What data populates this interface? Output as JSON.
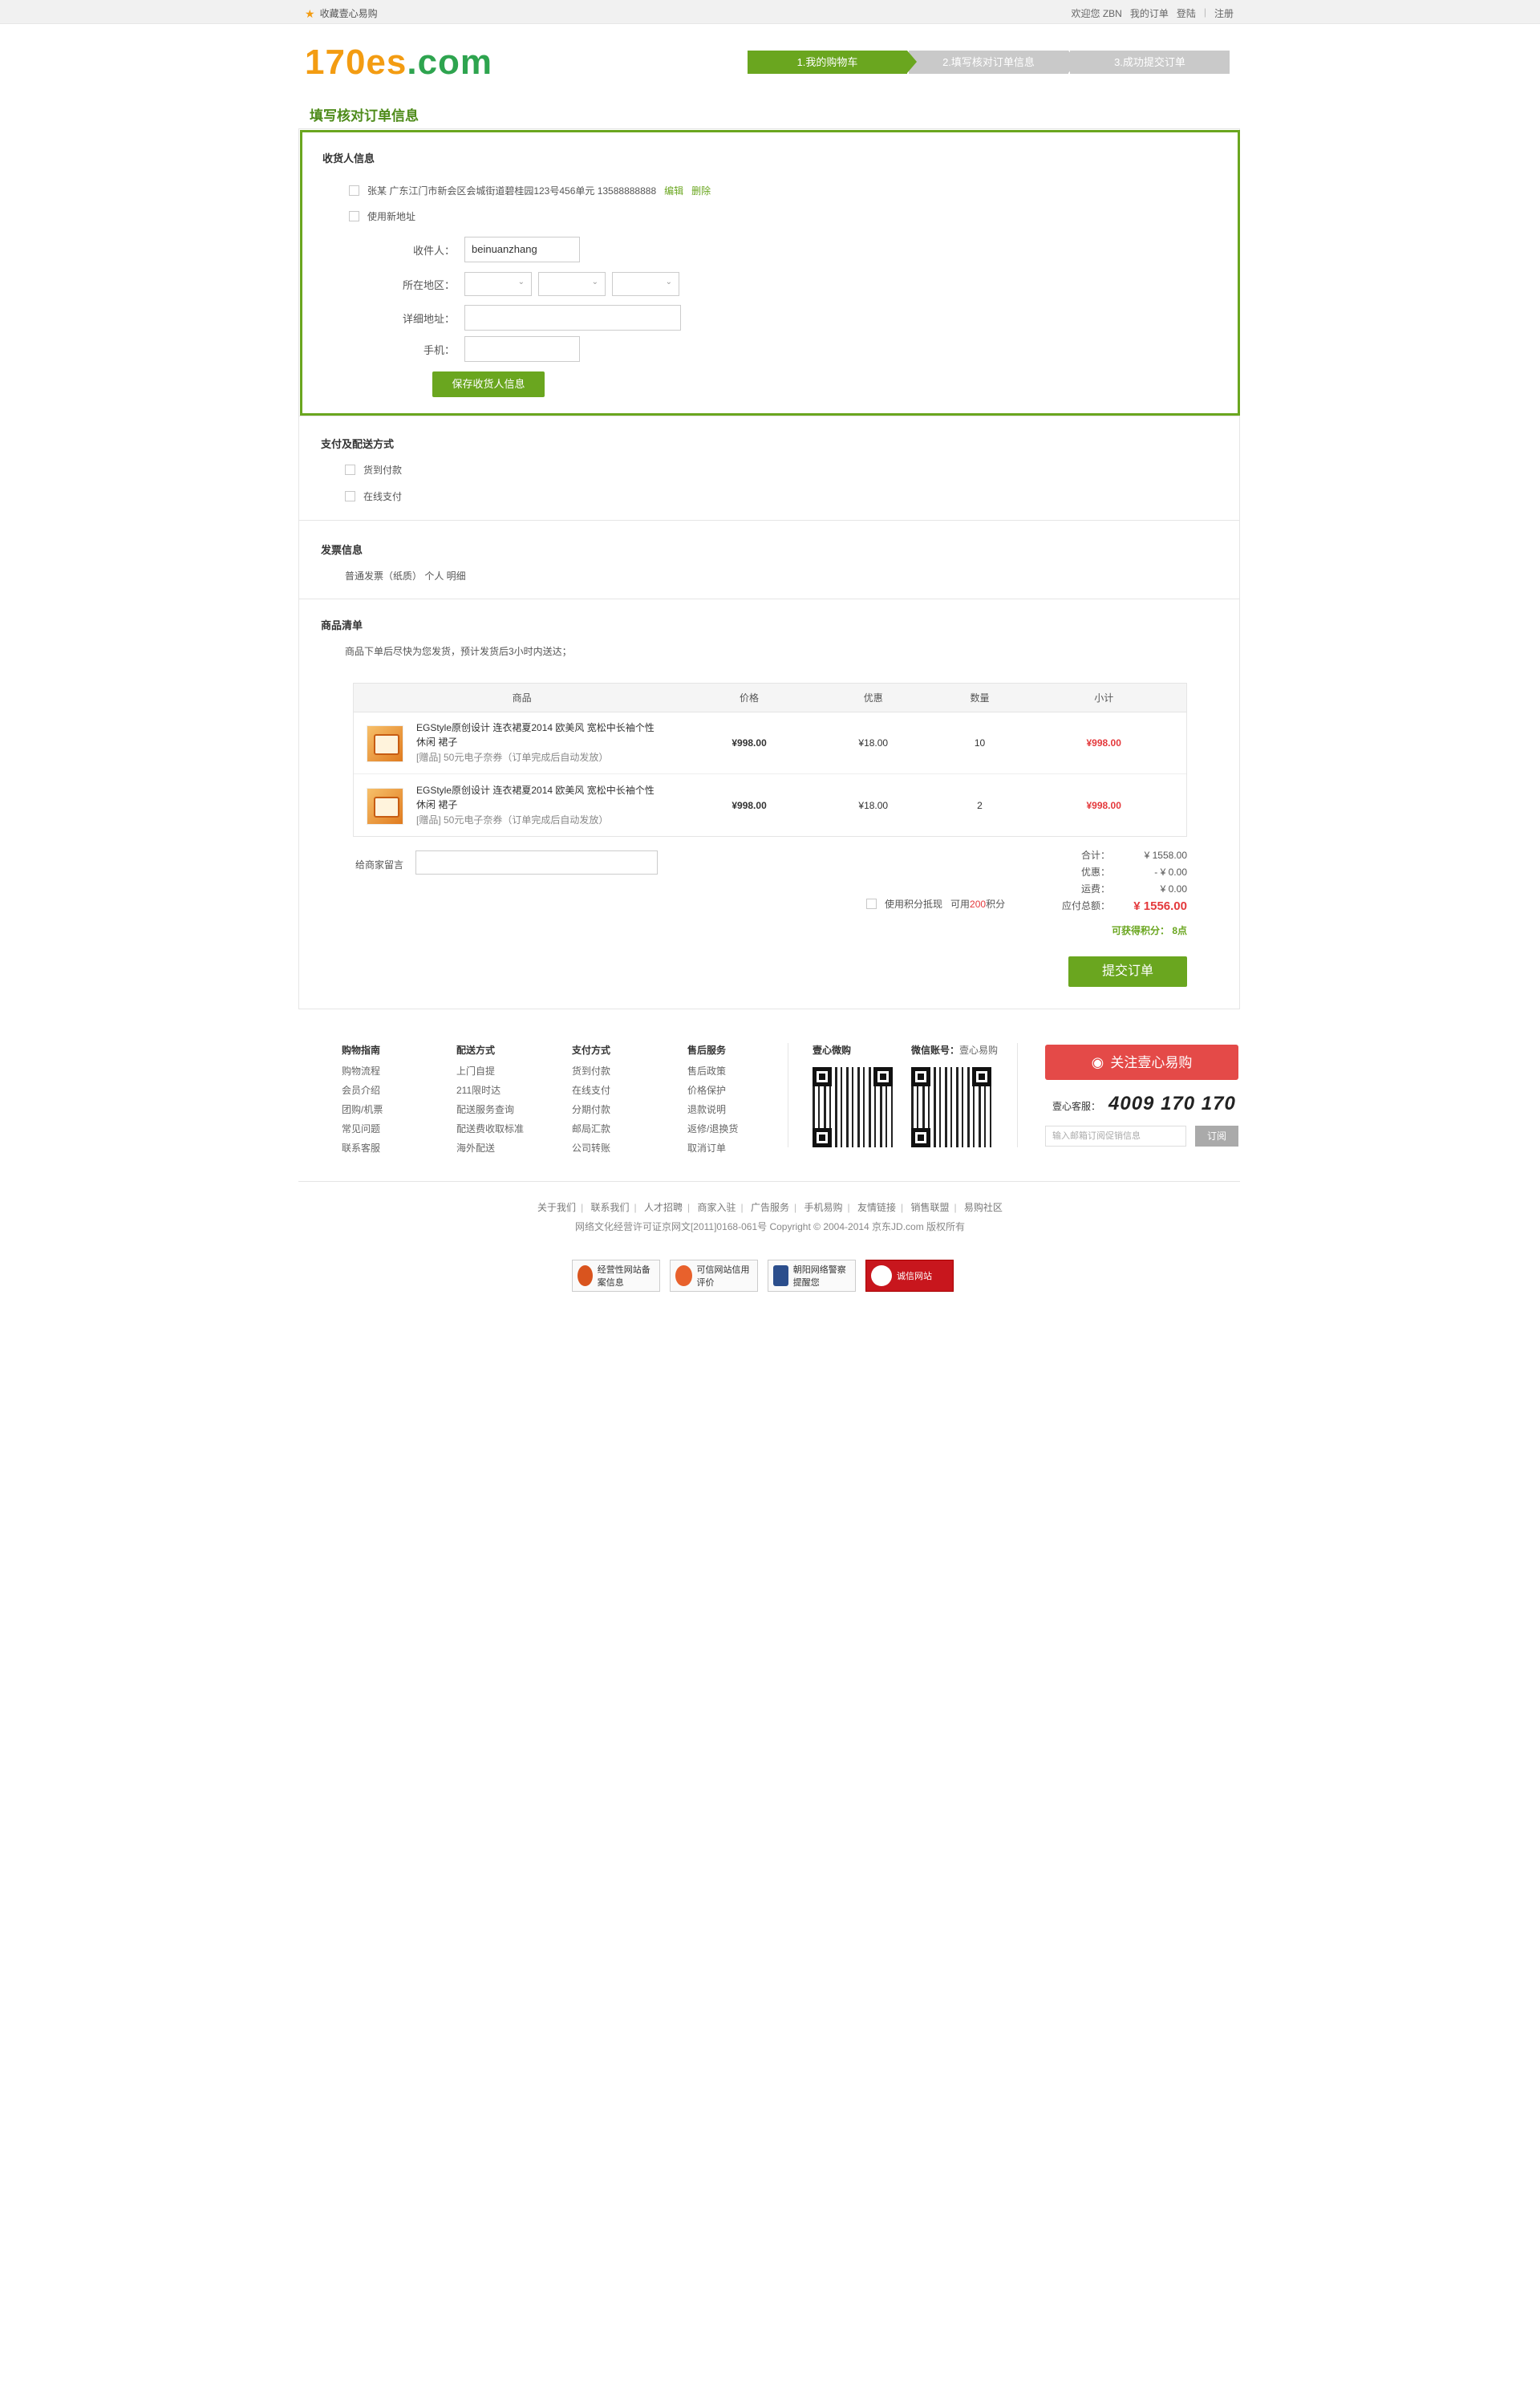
{
  "topbar": {
    "fav": "收藏壹心易购",
    "welcome": "欢迎您 ZBN",
    "orders": "我的订单",
    "login": "登陆",
    "sep": "|",
    "register": "注册"
  },
  "logo": {
    "part1": "170es",
    "part2": ".com"
  },
  "steps": [
    "1.我的购物车",
    "2.填写核对订单信息",
    "3.成功提交订单"
  ],
  "page_heading": "填写核对订单信息",
  "consignee": {
    "title": "收货人信息",
    "saved_address": "张某  广东江门市新会区会城街道碧桂园123号456单元  13588888888",
    "edit": "编辑",
    "delete": "删除",
    "use_new": "使用新地址",
    "labels": {
      "name": "收件人：",
      "region": "所在地区：",
      "detail": "详细地址：",
      "phone": "手机："
    },
    "name_value": "beinuanzhang",
    "save_button": "保存收货人信息"
  },
  "payment": {
    "title": "支付及配送方式",
    "options": [
      "货到付款",
      "在线支付"
    ]
  },
  "invoice": {
    "title": "发票信息",
    "text": "普通发票（纸质）  个人  明细"
  },
  "goods": {
    "title": "商品清单",
    "note": "商品下单后尽快为您发货，预计发货后3小时内送达；",
    "headers": [
      "商品",
      "价格",
      "优惠",
      "数量",
      "小计"
    ],
    "rows": [
      {
        "name": "EGStyle原创设计 连衣裙夏2014 欧美风 宽松中长袖个性休闲 裙子",
        "gift": "[赠品] 50元电子奈券（订单完成后自动发放）",
        "price": "¥998.00",
        "discount": "¥18.00",
        "qty": "10",
        "subtotal": "¥998.00"
      },
      {
        "name": "EGStyle原创设计 连衣裙夏2014 欧美风 宽松中长袖个性休闲 裙子",
        "gift": "[赠品] 50元电子奈券（订单完成后自动发放）",
        "price": "¥998.00",
        "discount": "¥18.00",
        "qty": "2",
        "subtotal": "¥998.00"
      }
    ],
    "message_label": "给商家留言",
    "summary": [
      {
        "k": "合计：",
        "v": "¥ 1558.00"
      },
      {
        "k": "优惠：",
        "v": "- ¥ 0.00"
      },
      {
        "k": "运费：",
        "v": "¥ 0.00"
      },
      {
        "k": "应付总额：",
        "v": "¥ 1556.00"
      }
    ],
    "points_use": "使用积分抵现",
    "points_avail_pre": "可用",
    "points_avail_num": "200",
    "points_avail_post": "积分",
    "earn": "可获得积分：  8点",
    "submit": "提交订单"
  },
  "footer": {
    "cols": [
      {
        "h": "购物指南",
        "items": [
          "购物流程",
          "会员介绍",
          "团购/机票",
          "常见问题",
          "联系客服"
        ]
      },
      {
        "h": "配送方式",
        "items": [
          "上门自提",
          "211限时达",
          "配送服务查询",
          "配送费收取标准",
          "海外配送"
        ]
      },
      {
        "h": "支付方式",
        "items": [
          "货到付款",
          "在线支付",
          "分期付款",
          "邮局汇款",
          "公司转账"
        ]
      },
      {
        "h": "售后服务",
        "items": [
          "售后政策",
          "价格保护",
          "退款说明",
          "返修/退换货",
          "取消订单"
        ]
      }
    ],
    "weibo_title": "壹心微购",
    "wechat_title": "微信账号：",
    "wechat_name": "壹心易购",
    "follow": "关注壹心易购",
    "hotline_label": "壹心客服：",
    "hotline": "4009 170 170",
    "subscribe_placeholder": "输入邮箱订阅促销信息",
    "subscribe_btn": "订阅",
    "links": [
      "关于我们",
      "联系我们",
      "人才招聘",
      "商家入驻",
      "广告服务",
      "手机易购",
      "友情链接",
      "销售联盟",
      "易购社区"
    ],
    "copyright": "网络文化经营许可证京网文[2011]0168-061号  Copyright © 2004-2014  京东JD.com 版权所有",
    "badges": [
      "经营性网站备案信息",
      "可信网站信用评价",
      "朝阳网络警察提醒您",
      "诚信网站"
    ]
  },
  "colors": {
    "green": "#6aa61f",
    "orange": "#f39c12",
    "red": "#e4393c",
    "weibo": "#e44a48"
  }
}
